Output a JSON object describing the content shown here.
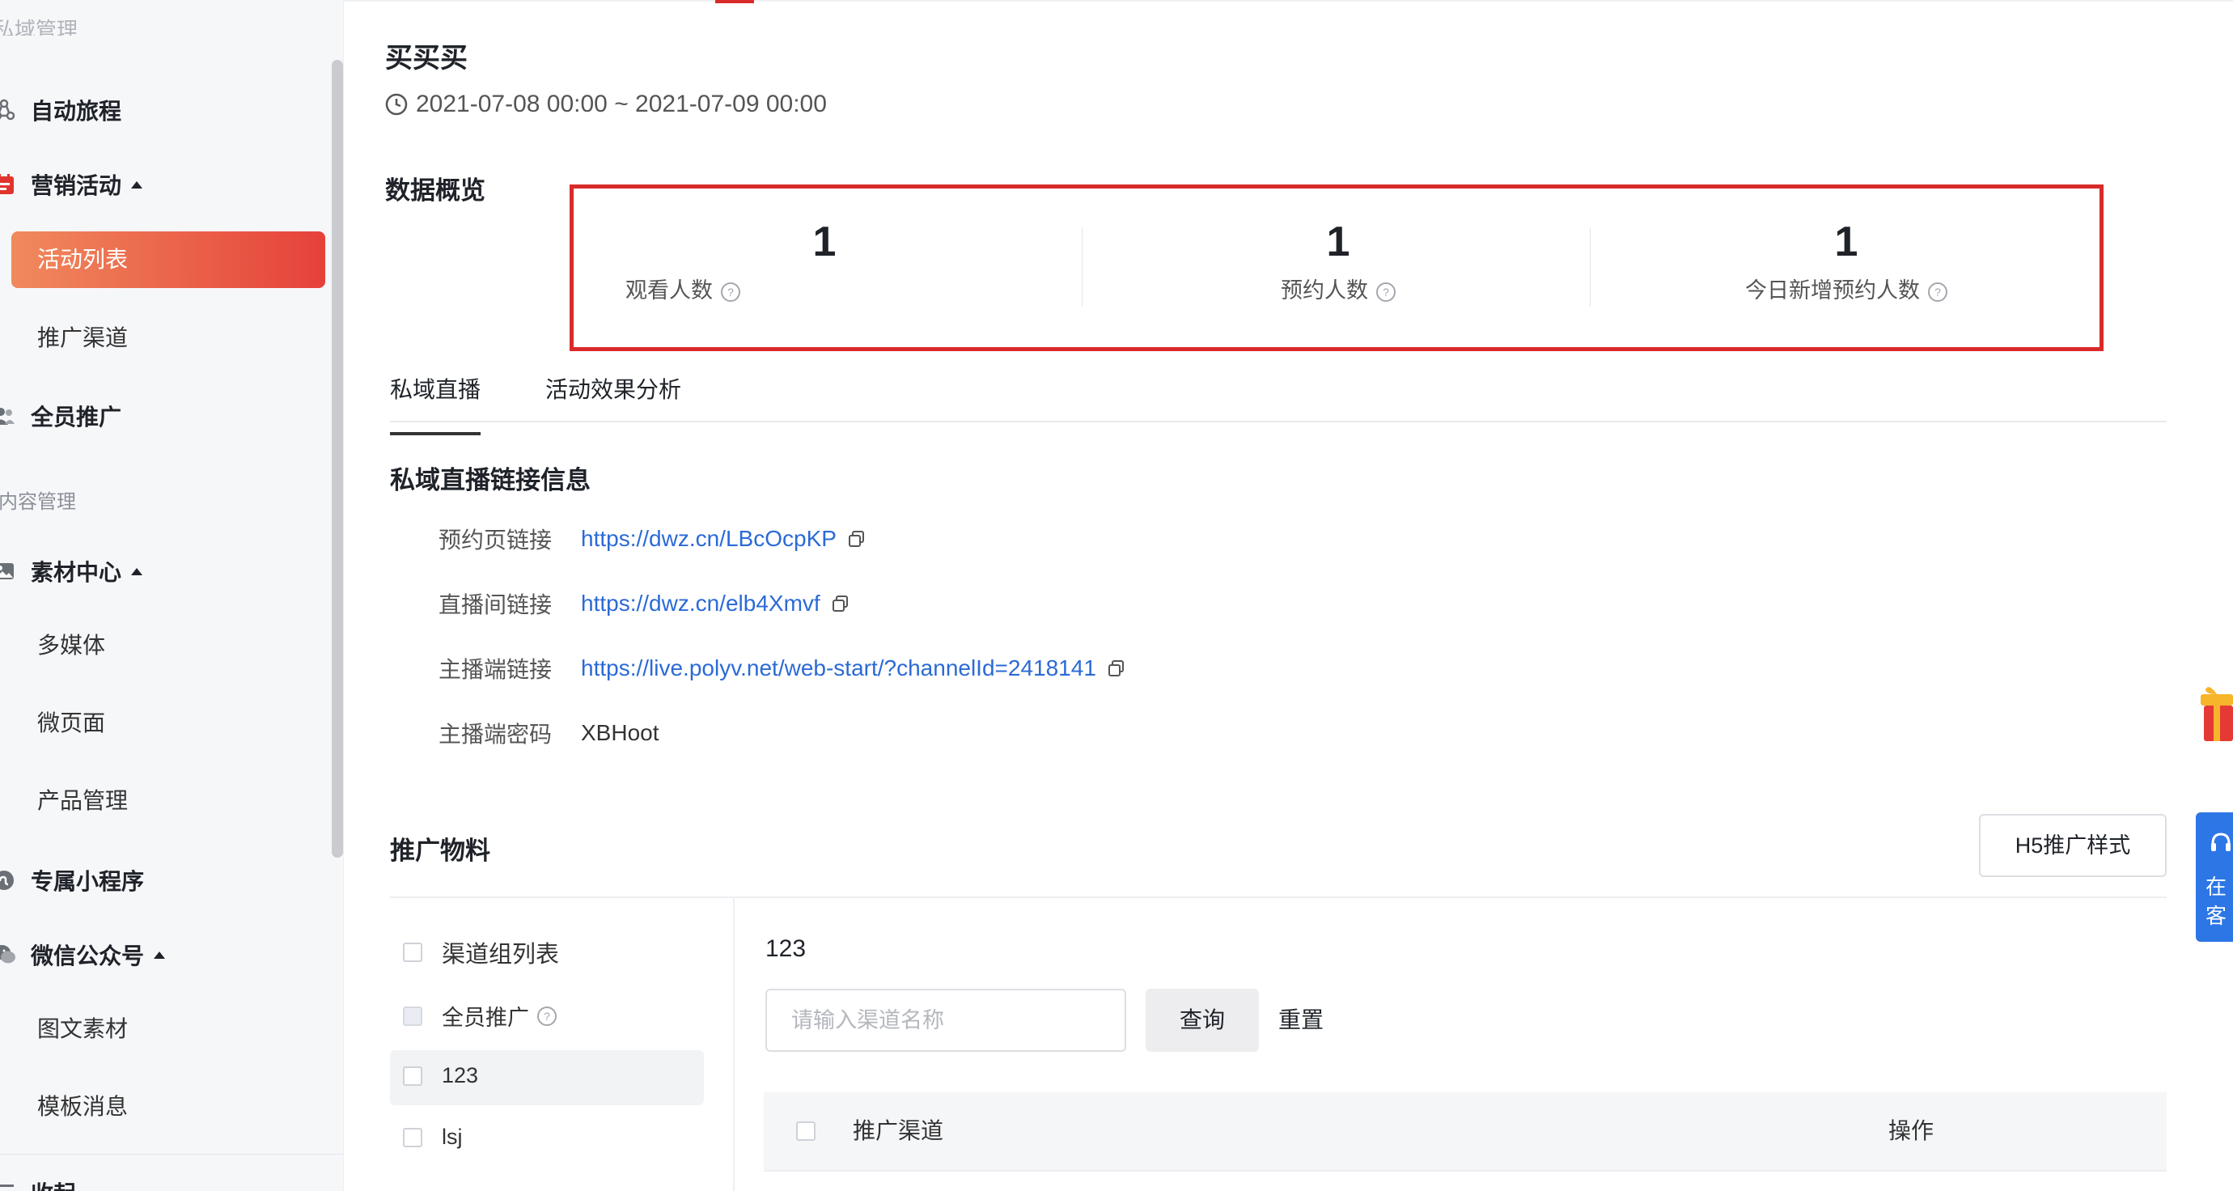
{
  "sidebar": {
    "cut_text": "私域管理",
    "groups": [
      {
        "label": "自动旅程",
        "icon": "journey-icon"
      },
      {
        "label": "营销活动",
        "icon": "calendar-icon"
      },
      {
        "label": "全员推广",
        "icon": "people-icon"
      },
      {
        "label": "素材中心",
        "icon": "image-icon"
      },
      {
        "label": "专属小程序",
        "icon": "miniprogram-icon"
      },
      {
        "label": "微信公众号",
        "icon": "wechat-icon"
      },
      {
        "label": "收起",
        "icon": "collapse-icon"
      }
    ],
    "marketing_items": [
      "活动列表",
      "推广渠道"
    ],
    "content_section": "内容管理",
    "material_items": [
      "多媒体",
      "微页面",
      "产品管理"
    ],
    "wechat_items": [
      "图文素材",
      "模板消息"
    ]
  },
  "header": {
    "title": "买买买",
    "date_range": "2021-07-08 00:00 ~ 2021-07-09 00:00"
  },
  "overview": {
    "label": "数据概览",
    "stats": [
      {
        "value": "1",
        "label": "观看人数"
      },
      {
        "value": "1",
        "label": "预约人数"
      },
      {
        "value": "1",
        "label": "今日新增预约人数"
      }
    ],
    "highlight_color": "#d92a2a"
  },
  "tabs": [
    {
      "label": "私域直播",
      "active": true
    },
    {
      "label": "活动效果分析",
      "active": false
    }
  ],
  "links": {
    "title": "私域直播链接信息",
    "rows": [
      {
        "key": "预约页链接",
        "value": "https://dwz.cn/LBcOcpKP"
      },
      {
        "key": "直播间链接",
        "value": "https://dwz.cn/elb4Xmvf"
      },
      {
        "key": "主播端链接",
        "value": "https://live.polyv.net/web-start/?channelId=2418141"
      },
      {
        "key": "主播端密码",
        "value": "XBHoot"
      }
    ]
  },
  "promo": {
    "title": "推广物料",
    "h5_button": "H5推广样式",
    "channel_groups": [
      "渠道组列表",
      "全员推广",
      "123",
      "lsj"
    ],
    "selected_group": "123",
    "search_placeholder": "请输入渠道名称",
    "query_button": "查询",
    "reset_button": "重置",
    "table_headers": [
      "推广渠道",
      "操作"
    ]
  },
  "float": {
    "service_text_1": "在",
    "service_text_2": "客"
  },
  "colors": {
    "accent_start": "#f08a5d",
    "accent_end": "#e6413a",
    "link": "#2b6ad6",
    "service": "#2d76e6"
  }
}
